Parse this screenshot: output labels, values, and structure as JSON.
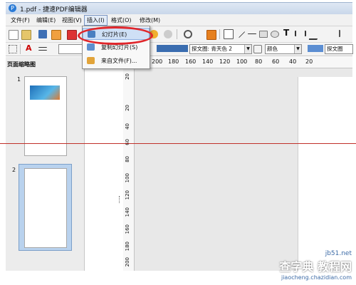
{
  "window": {
    "title": "1.pdf - 捷速PDF编辑器"
  },
  "menubar": {
    "items": [
      {
        "label": "文件(F)"
      },
      {
        "label": "编辑(E)"
      },
      {
        "label": "视图(V)"
      },
      {
        "label": "插入(I)"
      },
      {
        "label": "格式(O)"
      },
      {
        "label": "修改(M)"
      }
    ]
  },
  "insert_menu": {
    "items": [
      {
        "label": "幻灯片(E)",
        "icon": "slide-icon"
      },
      {
        "label": "复制幻灯片(S)",
        "icon": "duplicate-slide-icon"
      },
      {
        "label": "来自文件(F)...",
        "icon": "from-file-icon"
      }
    ]
  },
  "format_toolbar": {
    "fill_color_label": "探文圈: 青天色 2",
    "line_color_label": "颜色",
    "fill2_label": "探文圈"
  },
  "left_panel": {
    "title": "页面缩略图",
    "pages": [
      {
        "number": "1"
      },
      {
        "number": "2"
      }
    ]
  },
  "ruler": {
    "horizontal": [
      "200",
      "180",
      "160",
      "140",
      "120",
      "100",
      "80",
      "60",
      "40",
      "20"
    ],
    "vertical": [
      "20",
      "20",
      "40",
      "60",
      "80",
      "100",
      "120",
      "140",
      "160",
      "180",
      "200"
    ]
  },
  "watermark": {
    "site": "jb51.net",
    "brand": "查字典 教程网",
    "domain": "jiaocheng.chazidian.com"
  },
  "colors": {
    "highlight": "#e0262a",
    "selection": "#b9d2ee",
    "fill_swatch": "#3a6db0"
  }
}
